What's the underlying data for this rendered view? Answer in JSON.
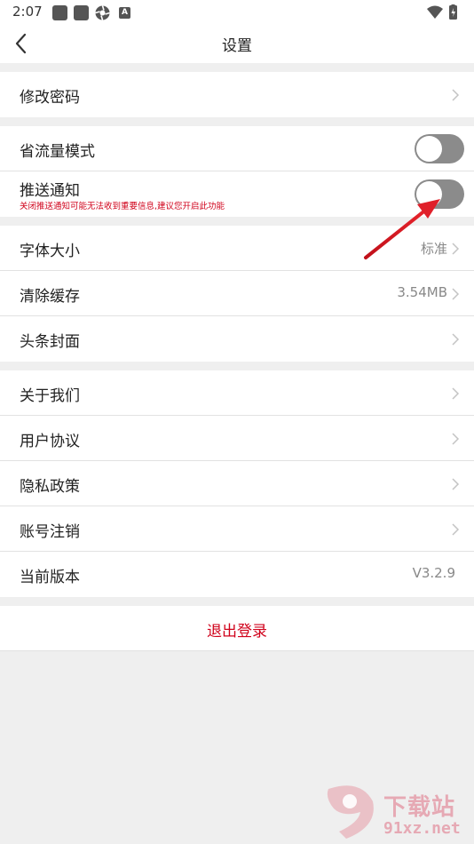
{
  "status": {
    "time": "2:07"
  },
  "nav": {
    "title": "设置"
  },
  "rows": {
    "password": {
      "label": "修改密码"
    },
    "datasaver": {
      "label": "省流量模式",
      "on": false
    },
    "push": {
      "label": "推送通知",
      "hint": "关闭推送通知可能无法收到重要信息,建议您开启此功能",
      "on": false
    },
    "fontsize": {
      "label": "字体大小",
      "value": "标准"
    },
    "cache": {
      "label": "清除缓存",
      "value": "3.54MB"
    },
    "cover": {
      "label": "头条封面"
    },
    "about": {
      "label": "关于我们"
    },
    "agreement": {
      "label": "用户协议"
    },
    "privacy": {
      "label": "隐私政策"
    },
    "cancel": {
      "label": "账号注销"
    },
    "version": {
      "label": "当前版本",
      "value": "V3.2.9"
    }
  },
  "logout": {
    "label": "退出登录"
  },
  "watermark": {
    "prefix": "9",
    "title": "下载站",
    "url": "91xz.net"
  },
  "colors": {
    "accent": "#d0021b",
    "toggle_off": "#8b8b8b",
    "background": "#efefef"
  }
}
